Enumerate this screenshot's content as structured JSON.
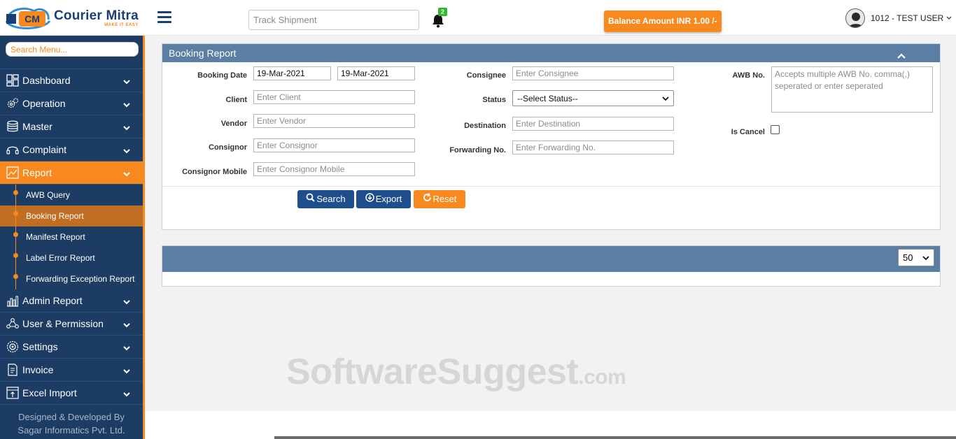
{
  "brand": {
    "name": "Courier Mitra",
    "tagline": "MAKE IT EASY",
    "logo_letters": "CM"
  },
  "header": {
    "track_placeholder": "Track Shipment",
    "notification_count": "2",
    "balance": "Balance Amount INR 1.00 /-",
    "user": "1012 - TEST USER"
  },
  "sidebar": {
    "search_placeholder": "Search Menu...",
    "items": [
      {
        "label": "Dashboard",
        "icon": "dashboard-icon"
      },
      {
        "label": "Operation",
        "icon": "gears-icon"
      },
      {
        "label": "Master",
        "icon": "database-icon"
      },
      {
        "label": "Complaint",
        "icon": "headset-icon"
      },
      {
        "label": "Report",
        "icon": "report-chart-icon",
        "active": true
      },
      {
        "label": "Admin Report",
        "icon": "bar-chart-icon"
      },
      {
        "label": "User & Permission",
        "icon": "users-network-icon"
      },
      {
        "label": "Settings",
        "icon": "settings-icon"
      },
      {
        "label": "Invoice",
        "icon": "invoice-icon"
      },
      {
        "label": "Excel Import",
        "icon": "excel-import-icon"
      }
    ],
    "report_sub": [
      {
        "label": "AWB Query"
      },
      {
        "label": "Booking Report",
        "active": true
      },
      {
        "label": "Manifest Report"
      },
      {
        "label": "Label Error Report"
      },
      {
        "label": "Forwarding Exception Report"
      }
    ],
    "footer_line1": "Designed & Developed By",
    "footer_line2": "Sagar Informatics Pvt. Ltd."
  },
  "report": {
    "title": "Booking Report",
    "labels": {
      "booking_date": "Booking Date",
      "client": "Client",
      "vendor": "Vendor",
      "consignor": "Consignor",
      "consignor_mobile": "Consignor Mobile",
      "consignee": "Consignee",
      "status": "Status",
      "destination": "Destination",
      "forwarding_no": "Forwarding No.",
      "awb_no": "AWB No.",
      "is_cancel": "Is Cancel"
    },
    "values": {
      "date_from": "19-Mar-2021",
      "date_to": "19-Mar-2021",
      "status_selected": "--Select Status--",
      "is_cancel": false
    },
    "placeholders": {
      "client": "Enter Client",
      "vendor": "Enter Vendor",
      "consignor": "Enter Consignor",
      "consignor_mobile": "Enter Consignor Mobile",
      "consignee": "Enter Consignee",
      "destination": "Enter Destination",
      "forwarding_no": "Enter Forwarding No.",
      "awb_no": "Accepts multiple AWB No. comma(,) seperated or enter seperated"
    },
    "buttons": {
      "search": "Search",
      "export": "Export",
      "reset": "Reset"
    }
  },
  "results": {
    "page_size": "50"
  },
  "watermark": {
    "main": "SoftwareSuggest",
    "suffix": ".com"
  },
  "colors": {
    "navy": "#1d3c64",
    "orange": "#f7891e",
    "panel_header": "#5b7fa4",
    "button_blue": "#1f4e8c",
    "badge_green": "#2db82d"
  }
}
